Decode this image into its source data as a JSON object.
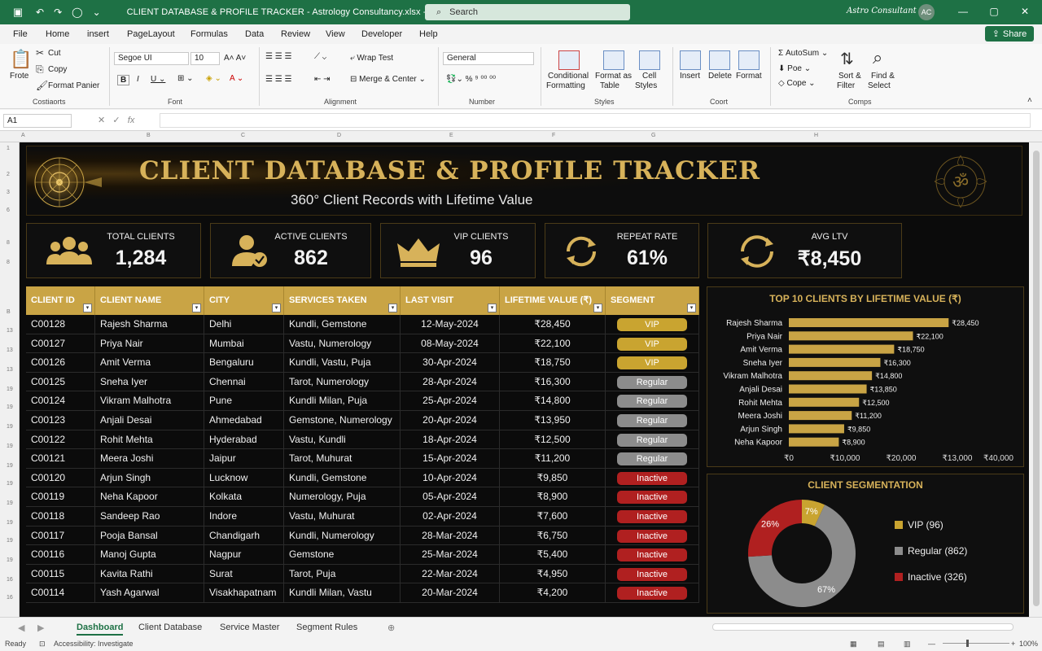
{
  "titlebar": {
    "doc_title": "CLIENT DATABASE & PROFILE TRACKER - Astrology Consultancy.xlsx - Excel",
    "search_placeholder": "Search",
    "user": "Astro Consultant",
    "avatar_initials": "AC"
  },
  "menu": {
    "tabs": [
      "File",
      "Home",
      "insert",
      "PageLayout",
      "Formulas",
      "Data",
      "Review",
      "View",
      "Developer",
      "Help"
    ],
    "share_label": "Share"
  },
  "ribbon": {
    "clipboard": {
      "paste": "Frote",
      "cut": "Cut",
      "copy": "Copy",
      "format_painter": "Format Panier",
      "group": "Costiaorts"
    },
    "font": {
      "name": "Segoe UI",
      "size": "10",
      "group": "Font"
    },
    "alignment": {
      "wrap": "Wrap Test",
      "merge": "Merge & Center",
      "group": "Alignment"
    },
    "number": {
      "format": "General",
      "group": "Number"
    },
    "styles": {
      "conditional": "Conditional",
      "conditional2": "Formatting",
      "format_table": "Format as",
      "format_table2": "Table",
      "cell_styles": "Cell",
      "cell_styles2": "Styles",
      "group": "Styles"
    },
    "cells": {
      "insert": "Insert",
      "delete": "Delete",
      "format": "Format",
      "group": "Coort"
    },
    "editing": {
      "autosum": "AutoSum",
      "fill": "Poe",
      "clear": "Cope",
      "sort": "Sort &",
      "sort2": "Filter",
      "find": "Find &",
      "find2": "Select",
      "group": "Comps"
    }
  },
  "formula_bar": {
    "cell_ref": "A1",
    "fx": "fx"
  },
  "columns": [
    "A",
    "B",
    "C",
    "D",
    "E",
    "F",
    "G",
    "H"
  ],
  "rows": [
    "1",
    "2",
    "3",
    "6",
    "8",
    "8",
    "B",
    "13",
    "13",
    "13",
    "19",
    "19",
    "19",
    "19",
    "19",
    "19",
    "19",
    "19",
    "19",
    "19",
    "16",
    "16",
    "18",
    "18",
    "16"
  ],
  "banner": {
    "title": "CLIENT DATABASE & PROFILE TRACKER",
    "subtitle": "360° Client Records with Lifetime Value"
  },
  "kpis": [
    {
      "label": "TOTAL CLIENTS",
      "value": "1,284",
      "icon": "group-icon"
    },
    {
      "label": "ACTIVE CLIENTS",
      "value": "862",
      "icon": "user-check-icon"
    },
    {
      "label": "VIP CLIENTS",
      "value": "96",
      "icon": "crown-icon"
    },
    {
      "label": "REPEAT RATE",
      "value": "61%",
      "icon": "repeat-icon"
    },
    {
      "label": "AVG LTV",
      "value": "₹8,450",
      "icon": "refresh-icon"
    }
  ],
  "table": {
    "headers": [
      "CLIENT ID",
      "CLIENT NAME",
      "CITY",
      "SERVICES TAKEN",
      "LAST VISIT",
      "LIFETIME VALUE (₹)",
      "SEGMENT"
    ],
    "rows": [
      [
        "C00128",
        "Rajesh Sharma",
        "Delhi",
        "Kundli, Gemstone",
        "12-May-2024",
        "₹28,450",
        "VIP"
      ],
      [
        "C00127",
        "Priya Nair",
        "Mumbai",
        "Vastu, Numerology",
        "08-May-2024",
        "₹22,100",
        "VIP"
      ],
      [
        "C00126",
        "Amit Verma",
        "Bengaluru",
        "Kundli, Vastu, Puja",
        "30-Apr-2024",
        "₹18,750",
        "VIP"
      ],
      [
        "C00125",
        "Sneha Iyer",
        "Chennai",
        "Tarot, Numerology",
        "28-Apr-2024",
        "₹16,300",
        "Regular"
      ],
      [
        "C00124",
        "Vikram Malhotra",
        "Pune",
        "Kundli Milan, Puja",
        "25-Apr-2024",
        "₹14,800",
        "Regular"
      ],
      [
        "C00123",
        "Anjali Desai",
        "Ahmedabad",
        "Gemstone, Numerology",
        "20-Apr-2024",
        "₹13,950",
        "Regular"
      ],
      [
        "C00122",
        "Rohit Mehta",
        "Hyderabad",
        "Vastu, Kundli",
        "18-Apr-2024",
        "₹12,500",
        "Regular"
      ],
      [
        "C00121",
        "Meera Joshi",
        "Jaipur",
        "Tarot, Muhurat",
        "15-Apr-2024",
        "₹11,200",
        "Regular"
      ],
      [
        "C00120",
        "Arjun Singh",
        "Lucknow",
        "Kundli, Gemstone",
        "10-Apr-2024",
        "₹9,850",
        "Inactive"
      ],
      [
        "C00119",
        "Neha Kapoor",
        "Kolkata",
        "Numerology, Puja",
        "05-Apr-2024",
        "₹8,900",
        "Inactive"
      ],
      [
        "C00118",
        "Sandeep Rao",
        "Indore",
        "Vastu, Muhurat",
        "02-Apr-2024",
        "₹7,600",
        "Inactive"
      ],
      [
        "C00117",
        "Pooja Bansal",
        "Chandigarh",
        "Kundli, Numerology",
        "28-Mar-2024",
        "₹6,750",
        "Inactive"
      ],
      [
        "C00116",
        "Manoj Gupta",
        "Nagpur",
        "Gemstone",
        "25-Mar-2024",
        "₹5,400",
        "Inactive"
      ],
      [
        "C00115",
        "Kavita Rathi",
        "Surat",
        "Tarot, Puja",
        "22-Mar-2024",
        "₹4,950",
        "Inactive"
      ],
      [
        "C00114",
        "Yash Agarwal",
        "Visakhapatnam",
        "Kundli Milan, Vastu",
        "20-Mar-2024",
        "₹4,200",
        "Inactive"
      ]
    ]
  },
  "colors": {
    "gold": "#c9a445",
    "vip": "#c9a430",
    "regular": "#8c8c8c",
    "inactive": "#b02020",
    "excel_green": "#1e7145"
  },
  "chart_data": [
    {
      "type": "bar",
      "orientation": "horizontal",
      "title": "TOP 10 CLIENTS BY LIFETIME VALUE (₹)",
      "categories": [
        "Rajesh Sharma",
        "Priya Nair",
        "Amit Verma",
        "Sneha Iyer",
        "Vikram Malhotra",
        "Anjali Desai",
        "Rohit Mehta",
        "Meera Joshi",
        "Arjun Singh",
        "Neha Kapoor"
      ],
      "values": [
        28450,
        22100,
        18750,
        16300,
        14800,
        13850,
        12500,
        11200,
        9850,
        8900
      ],
      "data_labels": [
        "₹28,450",
        "₹22,100",
        "₹18,750",
        "₹16,300",
        "₹14,800",
        "₹13,850",
        "₹12,500",
        "₹11,200",
        "₹9,850",
        "₹8,900"
      ],
      "xlim": [
        0,
        40000
      ],
      "xticks": [
        0,
        10000,
        20000,
        30000,
        40000
      ],
      "xtick_labels": [
        "₹0",
        "₹10,000",
        "₹20,000",
        "₹13,000",
        "₹40,000"
      ],
      "color": "#c9a445"
    },
    {
      "type": "pie",
      "variant": "donut",
      "title": "CLIENT SEGMENTATION",
      "categories": [
        "VIP",
        "Regular",
        "Inactive"
      ],
      "values": [
        7,
        67,
        26
      ],
      "slice_labels": [
        "7%",
        "67%",
        "26%"
      ],
      "legend": [
        "VIP (96)",
        "Regular (862)",
        "Inactive (326)"
      ],
      "legend_position": "right",
      "colors": [
        "#c9a430",
        "#8c8c8c",
        "#b02020"
      ]
    }
  ],
  "sheets": {
    "tabs": [
      "Dashboard",
      "Client Database",
      "Service Master",
      "Segment Rules"
    ],
    "active": "Dashboard"
  },
  "status": {
    "ready": "Ready",
    "accessibility": "Accessibility: Investigate",
    "zoom": "100%"
  }
}
